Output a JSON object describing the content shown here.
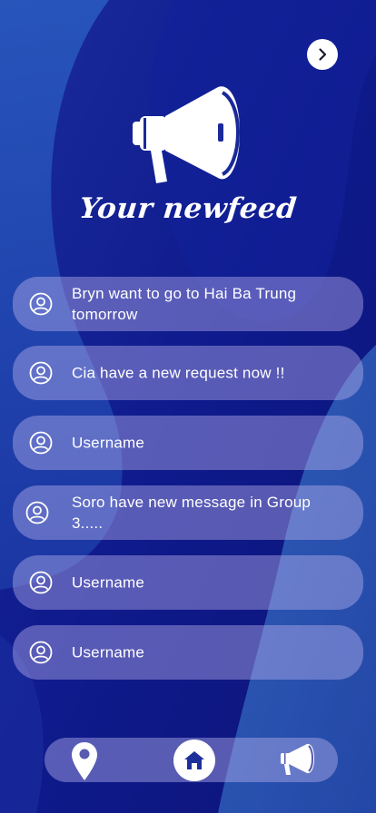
{
  "screen": {
    "title": "Your newfeed"
  },
  "feed": {
    "items": [
      {
        "text": "Bryn want to go to Hai Ba Trung tomorrow"
      },
      {
        "text": "Cia have a new request now !!"
      },
      {
        "text": "Username"
      },
      {
        "text": "Soro have new message in Group 3....."
      },
      {
        "text": "Username"
      },
      {
        "text": "Username"
      }
    ]
  },
  "icons": {
    "next": "chevron-right-icon",
    "hero": "megaphone-icon",
    "avatar": "user-circle-icon",
    "nav_location": "map-pin-icon",
    "nav_home": "home-icon",
    "nav_news": "megaphone-icon"
  },
  "colors": {
    "background": "#101b8e",
    "accent_dark": "#1d2f9a",
    "white": "#ffffff"
  }
}
